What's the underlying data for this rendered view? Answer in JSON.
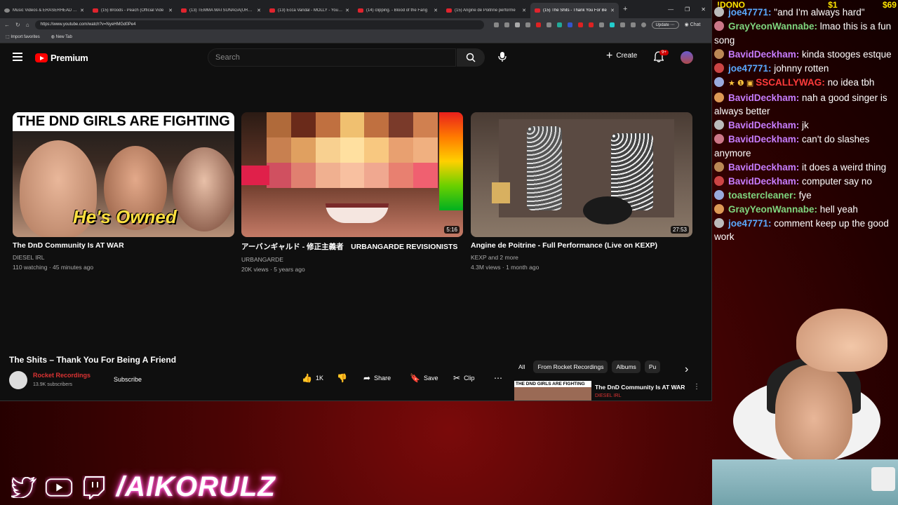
{
  "browser": {
    "tabs": [
      {
        "label": "Music Videos & ERASERHEAD RE",
        "active": false
      },
      {
        "label": "(15) Broods - Peach (Official Vide",
        "active": false
      },
      {
        "label": "(13) TEMMA MATSUNAGA(URBAN",
        "active": false
      },
      {
        "label": "(13) Ecca Vandal - MOLLY - YouTu",
        "active": false
      },
      {
        "label": "(14) clipping. - Blood of the Fang",
        "active": false
      },
      {
        "label": "(15) Angine de Poitrine performe",
        "active": false
      },
      {
        "label": "(15) The Shits - Thank You For Be",
        "active": true
      }
    ],
    "url": "https://www.youtube.com/watch?v=NyeHMGd0Pe4",
    "update_label": "Update",
    "chat_label": "Chat",
    "bookmarks": [
      "Import favorites",
      "New Tab"
    ]
  },
  "youtube": {
    "logo_text": "Premium",
    "search_placeholder": "Search",
    "create_label": "Create",
    "notification_badge": "9+",
    "end_cards": [
      {
        "title": "The DnD Community Is AT WAR",
        "channel": "DIESEL IRL",
        "meta": "110 watching · 45 minutes ago",
        "duration": "",
        "thumb_text": "THE DND GIRLS ARE FIGHTING",
        "thumb_overlay": "He's Owned"
      },
      {
        "title": "アーバンギャルド - 修正主義者　URBANGARDE REVISIONISTS",
        "channel": "URBANGARDE",
        "meta": "20K views · 5 years ago",
        "duration": "5:16"
      },
      {
        "title": "Angine de Poitrine - Full Performance (Live on KEXP)",
        "channel": "KEXP and 2 more",
        "meta": "4.3M views · 1 month ago",
        "duration": "27:53"
      }
    ],
    "video": {
      "title": "The Shits – Thank You For Being A Friend",
      "channel": "Rocket Recordings",
      "subscribers": "13.9K subscribers",
      "subscribe_label": "Subscribe",
      "likes": "1K",
      "share_label": "Share",
      "save_label": "Save",
      "clip_label": "Clip"
    },
    "chips": [
      "All",
      "From Rocket Recordings",
      "Albums",
      "Pu"
    ],
    "up_next": {
      "title": "The DnD Community Is AT WAR",
      "channel": "DIESEL IRL",
      "thumb_text": "THE DND GIRLS ARE FIGHTING"
    }
  },
  "overlay": {
    "dono_label": "!DONO",
    "dono_value_1": "$1",
    "dono_value_2": "$69",
    "chat": [
      {
        "user": "joe47771",
        "text": "\"and I'm always hard\"",
        "color": "#5aa9ff",
        "partial": true
      },
      {
        "user": "GrayYeonWannabe",
        "text": "lmao this is a fun song",
        "color": "#7fd67f"
      },
      {
        "user": "BavidDeckham",
        "text": "kinda stooges estque",
        "color": "#c77dff"
      },
      {
        "user": "joe47771",
        "text": "johnny rotten",
        "color": "#5aa9ff"
      },
      {
        "user": "SSCALLYWAG",
        "text": "no idea tbh",
        "color": "#ff3b3b",
        "badges": true
      },
      {
        "user": "BavidDeckham",
        "text": "nah a good singer is always better",
        "color": "#c77dff"
      },
      {
        "user": "BavidDeckham",
        "text": "jk",
        "color": "#c77dff"
      },
      {
        "user": "BavidDeckham",
        "text": "can't do slashes anymore",
        "color": "#c77dff"
      },
      {
        "user": "BavidDeckham",
        "text": "it does a weird thing",
        "color": "#c77dff"
      },
      {
        "user": "BavidDeckham",
        "text": "computer say no",
        "color": "#c77dff"
      },
      {
        "user": "toastercleaner",
        "text": "fye",
        "color": "#7fd67f"
      },
      {
        "user": "GrayYeonWannabe",
        "text": "hell yeah",
        "color": "#7fd67f"
      },
      {
        "user": "joe47771",
        "text": "comment keep up the good work",
        "color": "#5aa9ff"
      }
    ],
    "handle": "/AIKORULZ",
    "social_icons": [
      "twitter-icon",
      "youtube-icon",
      "twitch-icon"
    ]
  }
}
